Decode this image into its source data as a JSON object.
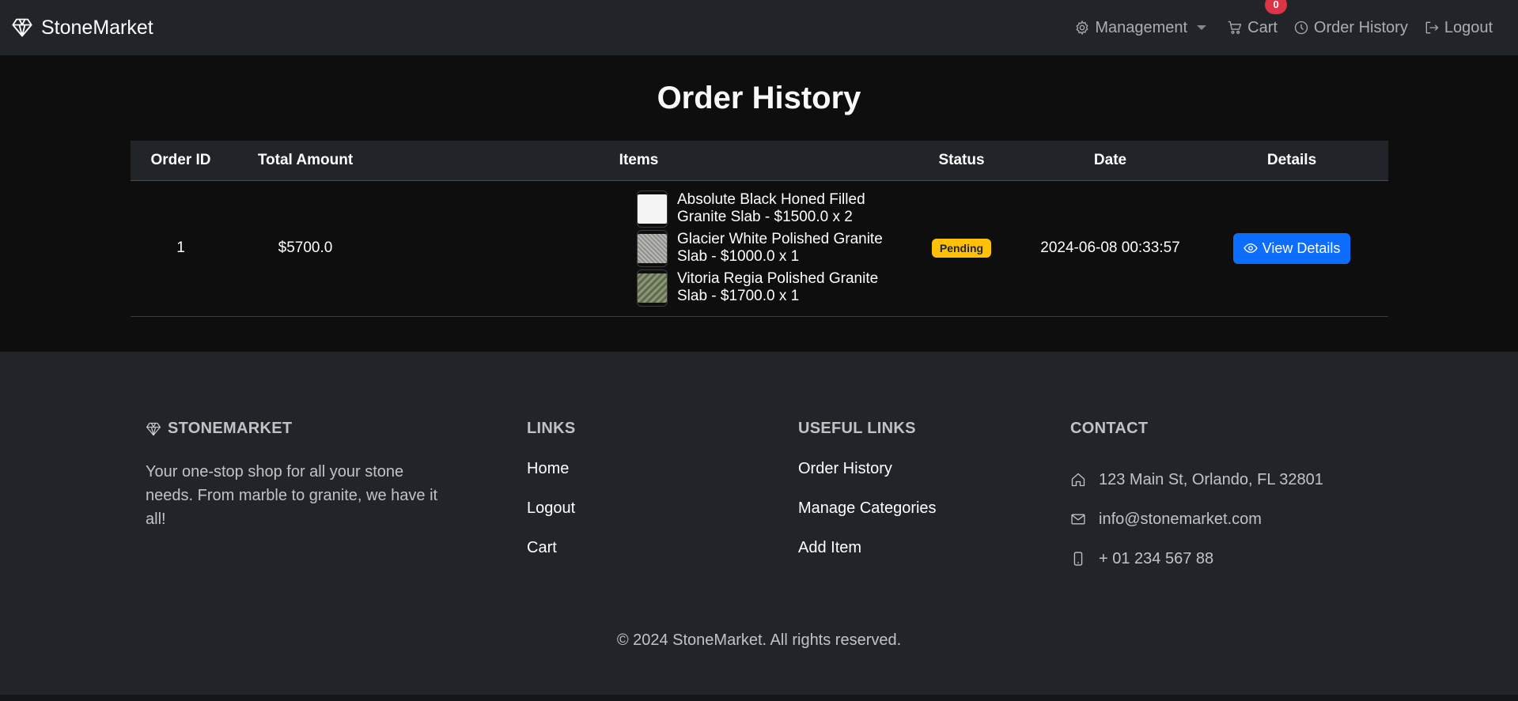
{
  "navbar": {
    "brand": "StoneMarket",
    "management_label": "Management",
    "cart_label": "Cart",
    "cart_count": "0",
    "order_history_label": "Order History",
    "logout_label": "Logout"
  },
  "page": {
    "title": "Order History"
  },
  "table": {
    "headers": [
      "Order ID",
      "Total Amount",
      "Items",
      "Status",
      "Date",
      "Details"
    ],
    "rows": [
      {
        "order_id": "1",
        "total": "$5700.0",
        "items": [
          {
            "text": "Absolute Black Honed Filled Granite Slab - $1500.0 x 2",
            "thumb_color": "#f4f4f4"
          },
          {
            "text": "Glacier White Polished Granite Slab - $1000.0 x 1",
            "thumb_color": "#a9a9a6"
          },
          {
            "text": "Vitoria Regia Polished Granite Slab - $1700.0 x 1",
            "thumb_color": "#7d8a6a"
          }
        ],
        "status": "Pending",
        "date": "2024-06-08 00:33:57",
        "details_label": "View Details"
      }
    ]
  },
  "footer": {
    "brand_heading": "STONEMARKET",
    "about": "Your one-stop shop for all your stone needs. From marble to granite, we have it all!",
    "links_heading": "LINKS",
    "links": [
      "Home",
      "Logout",
      "Cart"
    ],
    "useful_heading": "USEFUL LINKS",
    "useful_links": [
      "Order History",
      "Manage Categories",
      "Add Item"
    ],
    "contact_heading": "CONTACT",
    "address": "123 Main St, Orlando, FL 32801",
    "email": "info@stonemarket.com",
    "phone": "+ 01 234 567 88",
    "copyright": "© 2024 StoneMarket. All rights reserved."
  },
  "colors": {
    "navbar_bg": "#212529",
    "page_bg": "#0e0e0e",
    "badge_danger": "#dc3545",
    "status_warning": "#ffc107",
    "primary": "#0d6efd"
  }
}
